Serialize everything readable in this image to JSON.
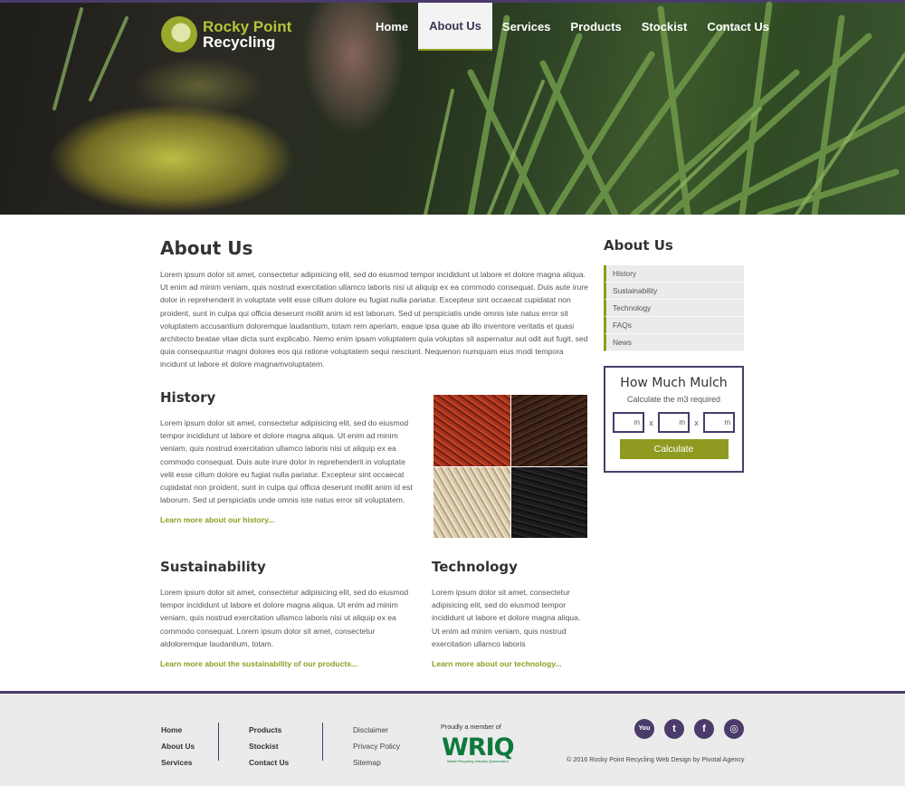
{
  "header": {
    "logo": {
      "line1": "Rocky Point",
      "line2": "Recycling"
    },
    "nav": [
      {
        "label": "Home"
      },
      {
        "label": "About Us"
      },
      {
        "label": "Services"
      },
      {
        "label": "Products"
      },
      {
        "label": "Stockist"
      },
      {
        "label": "Contact Us"
      }
    ]
  },
  "main": {
    "title": "About Us",
    "intro": "Lorem ipsum dolor sit amet, consectetur adipisicing elit, sed do eiusmod tempor incididunt ut labore et dolore magna aliqua. Ut enim ad minim veniam, quis nostrud exercitation ullamco laboris nisi ut aliquip ex ea commodo consequat. Duis aute irure dolor in reprehenderit in voluptate velit esse cillum dolore eu fugiat nulla pariatur. Excepteur sint occaecat cupidatat non proident, sunt in culpa qui officia deserunt mollit anim id est laborum. Sed ut perspiciatis unde omnis iste natus error sit voluptatem accusantium doloremque laudantium, totam rem aperiam, eaque ipsa quae ab illo inventore veritatis et quasi architecto beatae vitae dicta sunt explicabo. Nemo enim ipsam voluptatem quia voluptas sit aspernatur aut odit aut fugit, sed quia consequuntur magni dolores eos qui ratione voluptatem sequi nesciunt. Nequenon numquam eius modi tempora incidunt ut labore et dolore magnamvoluptatem.",
    "history": {
      "title": "History",
      "text": "Lorem ipsum dolor sit amet, consectetur adipisicing elit, sed do eiusmod tempor incididunt ut labore et dolore magna aliqua. Ut enim ad minim veniam, quis nostrud exercitation ullamco laboris nisi ut aliquip ex ea commodo consequat. Duis aute irure dolor in reprehenderit in voluptate velit esse cillum dolore eu fugiat nulla pariatur. Excepteur sint occaecat cupidatat non proident, sunt in culpa qui officia deserunt mollit anim id est laborum. Sed ut perspiciatis unde omnis iste natus error sit voluptatem.",
      "link": "Learn more about our history..."
    },
    "sustainability": {
      "title": "Sustainability",
      "text": "Lorem ipsum dolor sit amet, consectetur adipisicing elit, sed do eiusmod tempor incididunt ut labore et dolore magna aliqua. Ut enim ad minim veniam, quis nostrud exercitation ullamco laboris nisi ut aliquip ex ea commodo consequat. Lorem ipsum dolor sit amet, consectetur aldoloremque laudantium, totam.",
      "link": "Learn more about the sustainability of our products..."
    },
    "technology": {
      "title": "Technology",
      "text": "Lorem ipsum dolor sit amet, consectetur adipisicing elit, sed do eiusmod tempor incididunt ut labore et dolore magna aliqua. Ut enim ad minim veniam, quis nostrud exercitation ullamco laboris",
      "link": "Learn more about our technology..."
    }
  },
  "sidebar": {
    "title": "About Us",
    "items": [
      {
        "label": "History"
      },
      {
        "label": "Sustainability"
      },
      {
        "label": "Technology"
      },
      {
        "label": "FAQs"
      },
      {
        "label": "News"
      }
    ]
  },
  "calculator": {
    "title": "How Much Mulch",
    "subtitle": "Calculate the m3 required",
    "unit": "m",
    "separator": "x",
    "button": "Calculate"
  },
  "footer": {
    "col1": [
      {
        "label": "Home"
      },
      {
        "label": "About Us"
      },
      {
        "label": "Services"
      }
    ],
    "col2": [
      {
        "label": "Products"
      },
      {
        "label": "Stockist"
      },
      {
        "label": "Contact Us"
      }
    ],
    "col3": [
      {
        "label": "Disclaimer"
      },
      {
        "label": "Privacy Policy"
      },
      {
        "label": "Sitemap"
      }
    ],
    "member_text": "Proudly a member of",
    "member_logo": "WRIQ",
    "member_logo_sub": "Waste Recycling Industry Queensland",
    "social": [
      {
        "icon": "youtube-icon",
        "glyph": "You"
      },
      {
        "icon": "twitter-icon",
        "glyph": "t"
      },
      {
        "icon": "facebook-icon",
        "glyph": "f"
      },
      {
        "icon": "instagram-icon",
        "glyph": "◎"
      }
    ],
    "copyright": "© 2016 Rocky Point Recycling Web Design by Pivotal Agency"
  },
  "colors": {
    "brand_purple": "#4a3b6b",
    "brand_green": "#8f9b20"
  }
}
